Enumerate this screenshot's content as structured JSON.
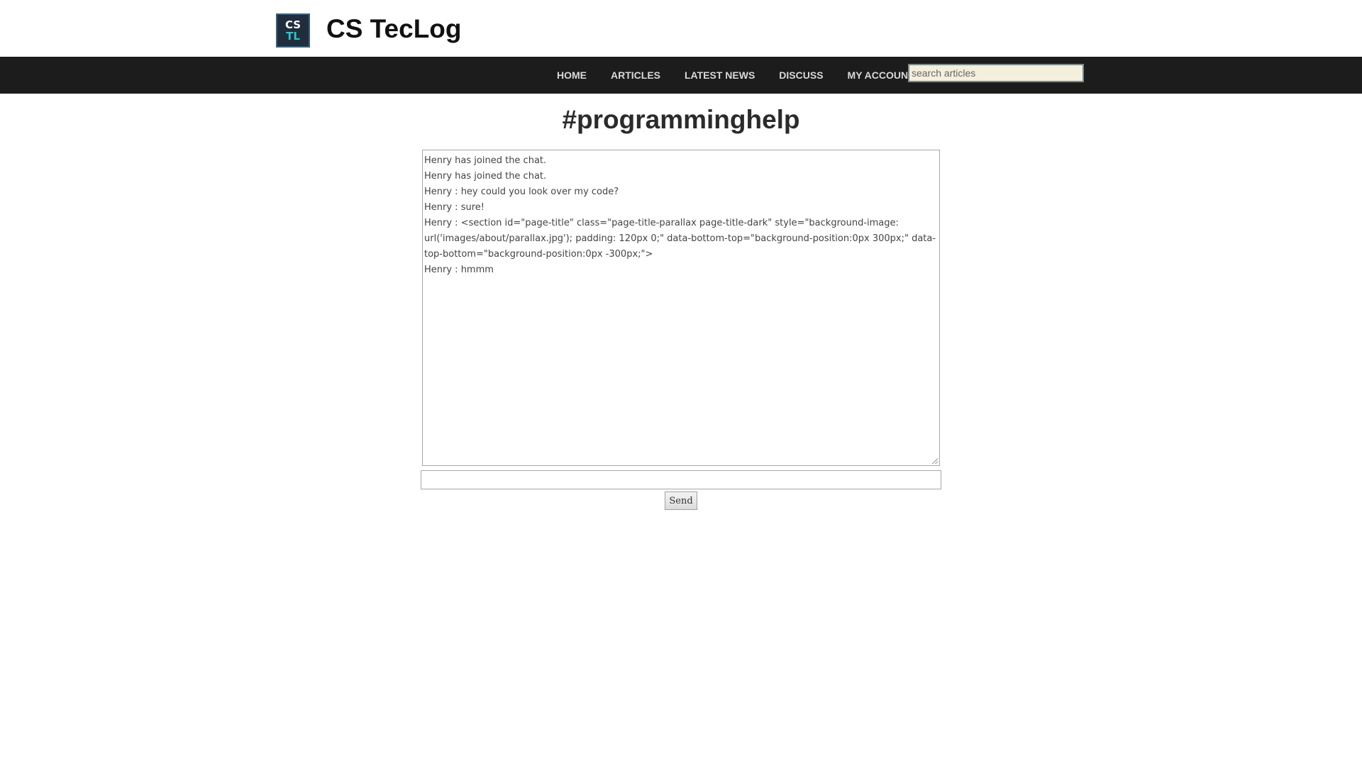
{
  "site": {
    "logo_line1": "CS",
    "logo_line2": "TL",
    "title": "CS TecLog"
  },
  "nav": {
    "items": [
      {
        "label": "HOME"
      },
      {
        "label": "ARTICLES"
      },
      {
        "label": "LATEST NEWS"
      },
      {
        "label": "DISCUSS"
      },
      {
        "label": "MY ACCOUNT"
      }
    ],
    "search_placeholder": "search articles"
  },
  "chat": {
    "channel": "#programminghelp",
    "messages": [
      "Henry has joined the chat.",
      "Henry has joined the chat.",
      "Henry : hey could you look over my code?",
      "Henry : sure!",
      "Henry : <section id=\"page-title\" class=\"page-title-parallax page-title-dark\" style=\"background-image: url('images/about/parallax.jpg'); padding: 120px 0;\" data-bottom-top=\"background-position:0px 300px;\" data-top-bottom=\"background-position:0px -300px;\">",
      "Henry : hmmm"
    ],
    "input_value": "",
    "send_label": "Send"
  },
  "colors": {
    "navbar_bg": "#1c1c1c",
    "nav_text": "#d9d9d9",
    "search_bg": "#f5efde",
    "logo_bg": "#1f2d3d",
    "logo_accent": "#35c2c9"
  }
}
